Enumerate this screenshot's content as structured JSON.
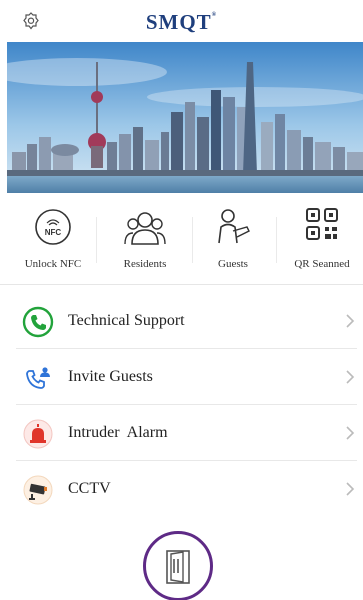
{
  "header": {
    "brand": "SMQT",
    "brand_mark": "®",
    "settings_icon": "settings-gear-icon"
  },
  "banner": {
    "description_icon": "city-skyline-image"
  },
  "quick_actions": [
    {
      "label": "Unlock NFC",
      "icon": "nfc-icon"
    },
    {
      "label": "Residents",
      "icon": "residents-icon"
    },
    {
      "label": "Guests",
      "icon": "guest-icon"
    },
    {
      "label": "QR Seanned",
      "icon": "qr-code-icon"
    }
  ],
  "menu": [
    {
      "label": "Technical Support",
      "icon": "phone-icon",
      "color": "#22a33b"
    },
    {
      "label": "Invite Guests",
      "icon": "invite-call-icon",
      "color": "#2f74d8"
    },
    {
      "label": "Intruder  Alarm",
      "icon": "alarm-siren-icon",
      "color": "#e0352b"
    },
    {
      "label": "CCTV",
      "icon": "cctv-camera-icon",
      "color": "#e07a2b"
    }
  ],
  "door_button": {
    "icon": "door-icon",
    "color": "#5e2a86"
  },
  "colors": {
    "brand": "#1f3f7d",
    "accent": "#5e2a86"
  }
}
